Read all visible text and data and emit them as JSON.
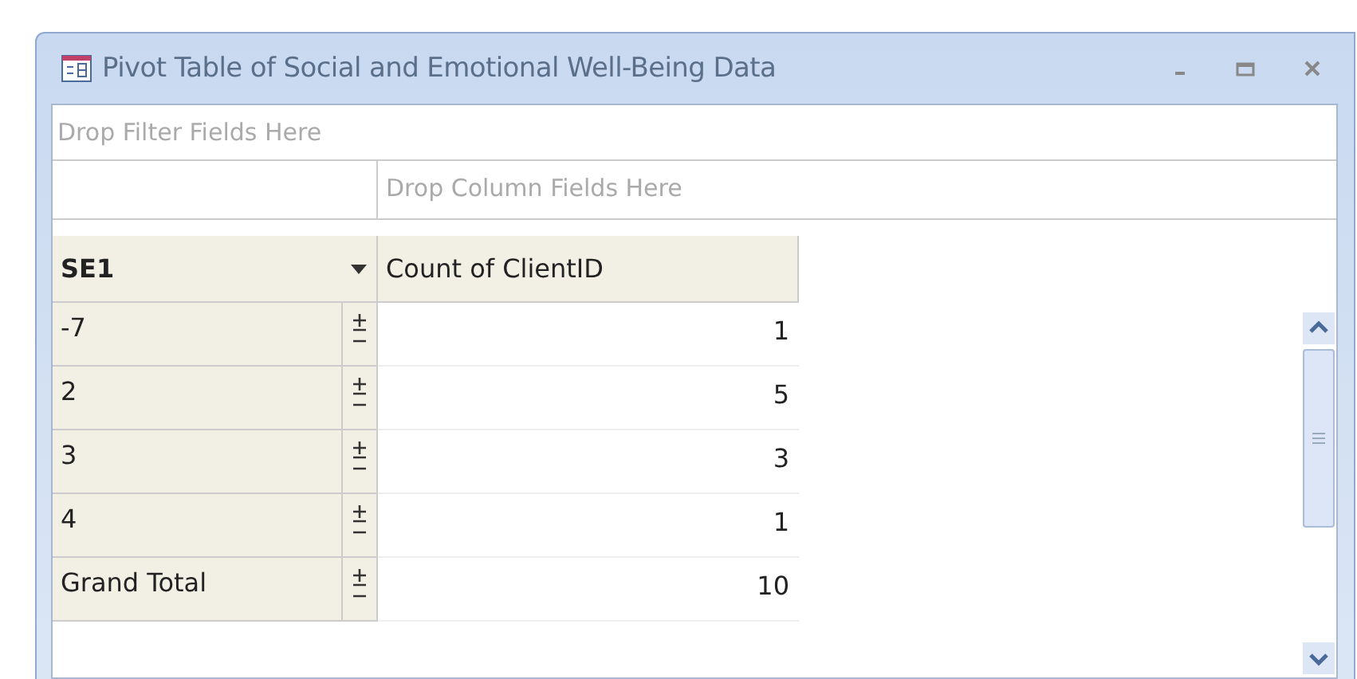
{
  "window": {
    "title": "Pivot Table of Social and Emotional Well-Being Data"
  },
  "filter_area": {
    "placeholder": "Drop Filter Fields Here"
  },
  "column_area": {
    "placeholder": "Drop Column Fields Here"
  },
  "row_field": {
    "label": "SE1"
  },
  "data_field": {
    "label": "Count of ClientID"
  },
  "rows": [
    {
      "label": "-7",
      "value": "1"
    },
    {
      "label": "2",
      "value": "5"
    },
    {
      "label": "3",
      "value": "3"
    },
    {
      "label": "4",
      "value": "1"
    },
    {
      "label": "Grand Total",
      "value": "10"
    }
  ]
}
